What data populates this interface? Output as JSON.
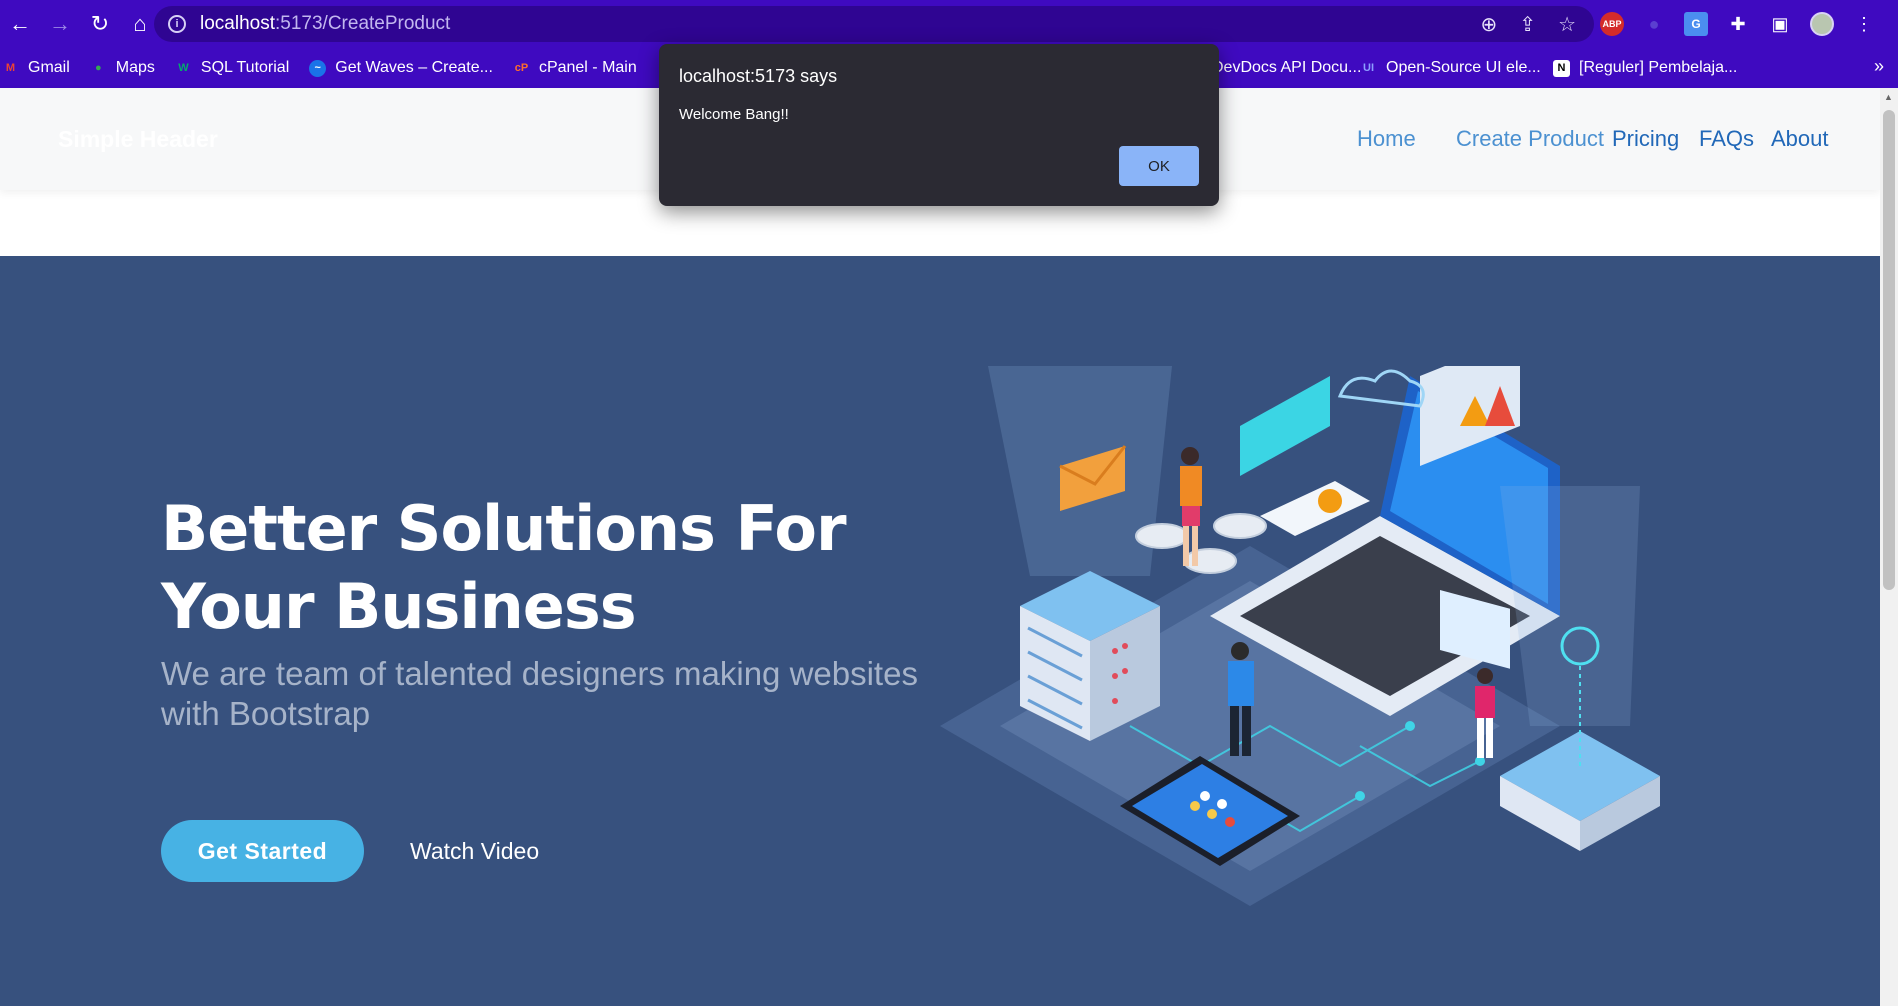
{
  "browser": {
    "url_host": "localhost",
    "url_path": ":5173/CreateProduct",
    "bookmarks": [
      {
        "label": "Gmail",
        "icon": "gmail-icon",
        "color": "#ea4335",
        "glyph": "M"
      },
      {
        "label": "Maps",
        "icon": "maps-icon",
        "color": "#34a853",
        "glyph": "●"
      },
      {
        "label": "SQL Tutorial",
        "icon": "w3-icon",
        "color": "#04aa6d",
        "glyph": "W"
      },
      {
        "label": "Get Waves – Create...",
        "icon": "waves-icon",
        "color": "#1a73e8",
        "glyph": "~"
      },
      {
        "label": "cPanel - Main",
        "icon": "cpanel-icon",
        "color": "#ff6c2c",
        "glyph": "cP"
      },
      {
        "label": "",
        "icon": "extension-bookmark-icon",
        "color": "#8e44ad",
        "glyph": "◆"
      },
      {
        "label": "DevDocs API Docu...",
        "icon": "devdocs-icon",
        "color": "#3f0ac0",
        "glyph": ""
      },
      {
        "label": "Open-Source UI ele...",
        "icon": "ui-icon",
        "color": "#5c6bc0",
        "glyph": "UI"
      },
      {
        "label": "[Reguler] Pembelaja...",
        "icon": "notion-icon",
        "color": "#ffffff",
        "glyph": "N"
      }
    ],
    "more_bookmarks": "»"
  },
  "header": {
    "brand": "Simple Header",
    "nav": [
      "Home",
      "Create Product",
      "Pricing",
      "FAQs",
      "About"
    ]
  },
  "hero": {
    "title_line1": "Better Solutions For",
    "title_line2": "Your Business",
    "subtitle": "We are team of talented designers making websites with Bootstrap",
    "cta_label": "Get Started",
    "watch_label": "Watch Video"
  },
  "dialog": {
    "title": "localhost:5173 says",
    "message": "Welcome Bang!!",
    "ok_label": "OK"
  },
  "colors": {
    "browser_chrome": "#3f0ac0",
    "hero_background": "#37517e",
    "cta_button": "#47b2e4",
    "nav_link": "#4c91d1"
  }
}
